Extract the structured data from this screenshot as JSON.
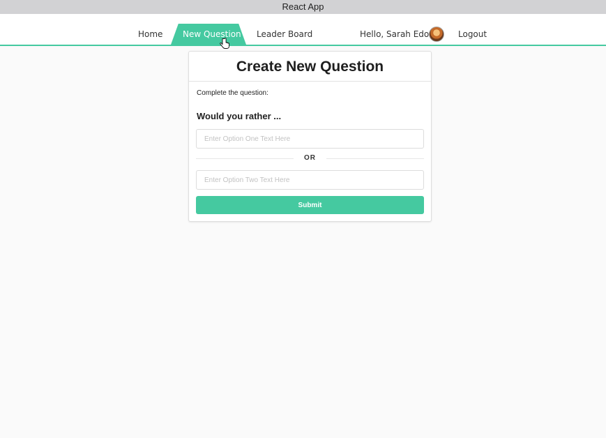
{
  "window": {
    "title": "React App"
  },
  "nav": {
    "home": "Home",
    "new_question": "New Question",
    "leader_board": "Leader Board",
    "greeting": "Hello, Sarah Edo",
    "logout": "Logout",
    "active_color": "#45c9a0"
  },
  "form": {
    "title": "Create New Question",
    "hint": "Complete the question:",
    "prompt": "Would you rather ...",
    "option_one": {
      "value": "",
      "placeholder": "Enter Option One Text Here"
    },
    "separator": "OR",
    "option_two": {
      "value": "",
      "placeholder": "Enter Option Two Text Here"
    },
    "submit_label": "Submit"
  }
}
